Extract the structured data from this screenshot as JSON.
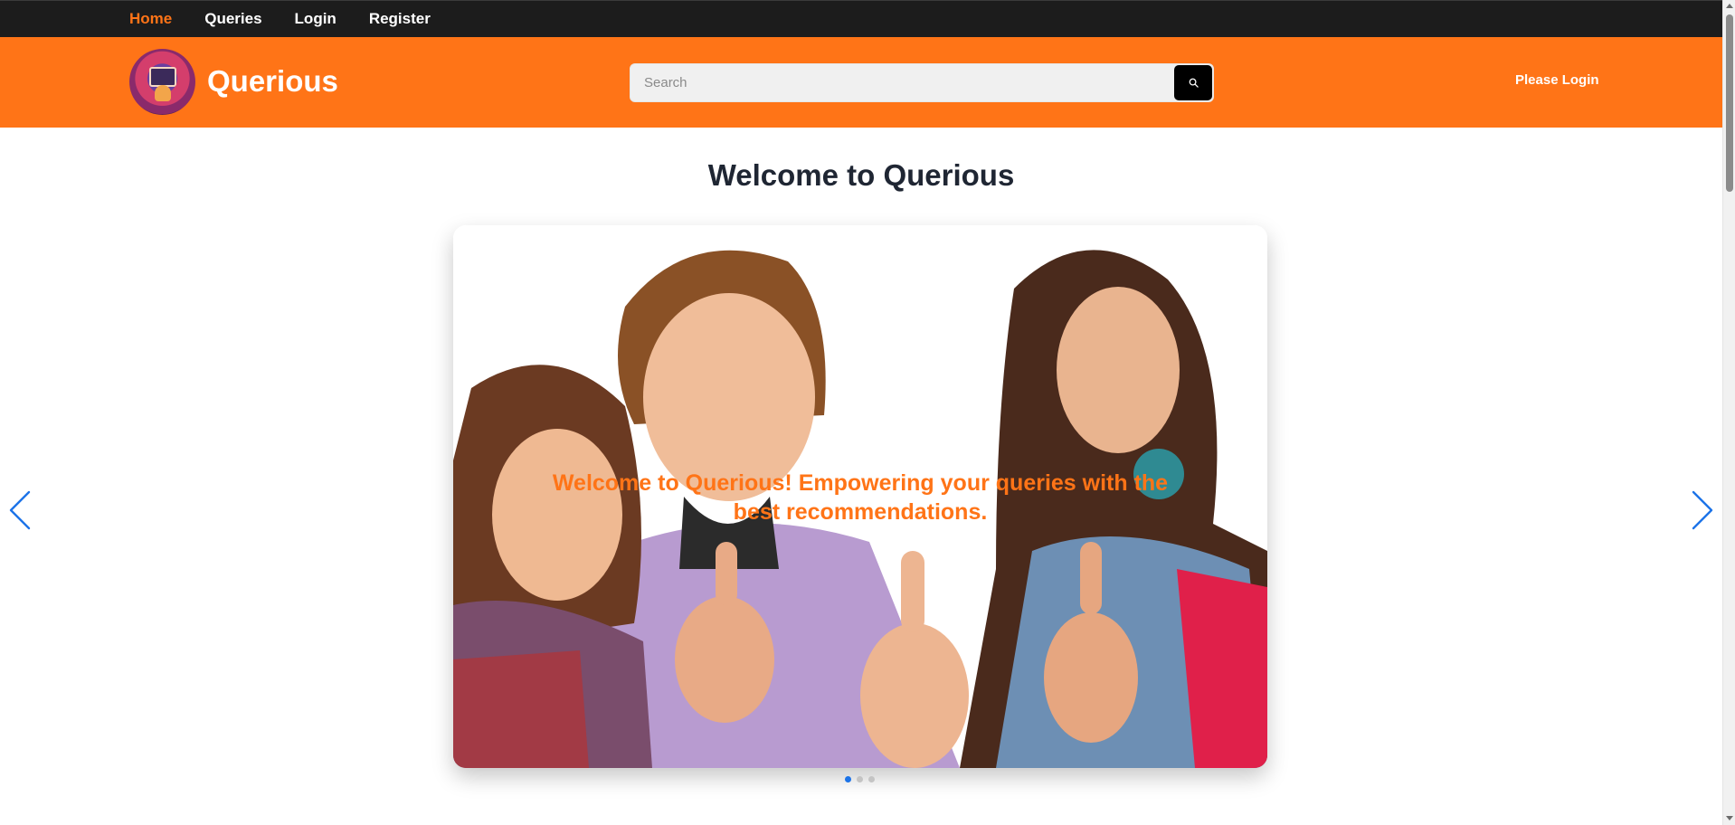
{
  "nav": {
    "items": [
      {
        "label": "Home",
        "active": true
      },
      {
        "label": "Queries",
        "active": false
      },
      {
        "label": "Login",
        "active": false
      },
      {
        "label": "Register",
        "active": false
      }
    ]
  },
  "header": {
    "brand": "Querious",
    "search": {
      "placeholder": "Search",
      "value": "",
      "button_icon": "search-icon"
    },
    "login_link": "Please Login"
  },
  "main": {
    "title": "Welcome to Querious",
    "carousel": {
      "caption": "Welcome to Querious! Empowering your queries with the best recommendations.",
      "slide_count": 3,
      "active_slide": 1,
      "prev_icon": "chevron-left-icon",
      "next_icon": "chevron-right-icon"
    }
  },
  "colors": {
    "accent": "#ff7417",
    "topnav_bg": "#1c1c1c",
    "title_text": "#1f2633",
    "carousel_control": "#1c73e8"
  }
}
